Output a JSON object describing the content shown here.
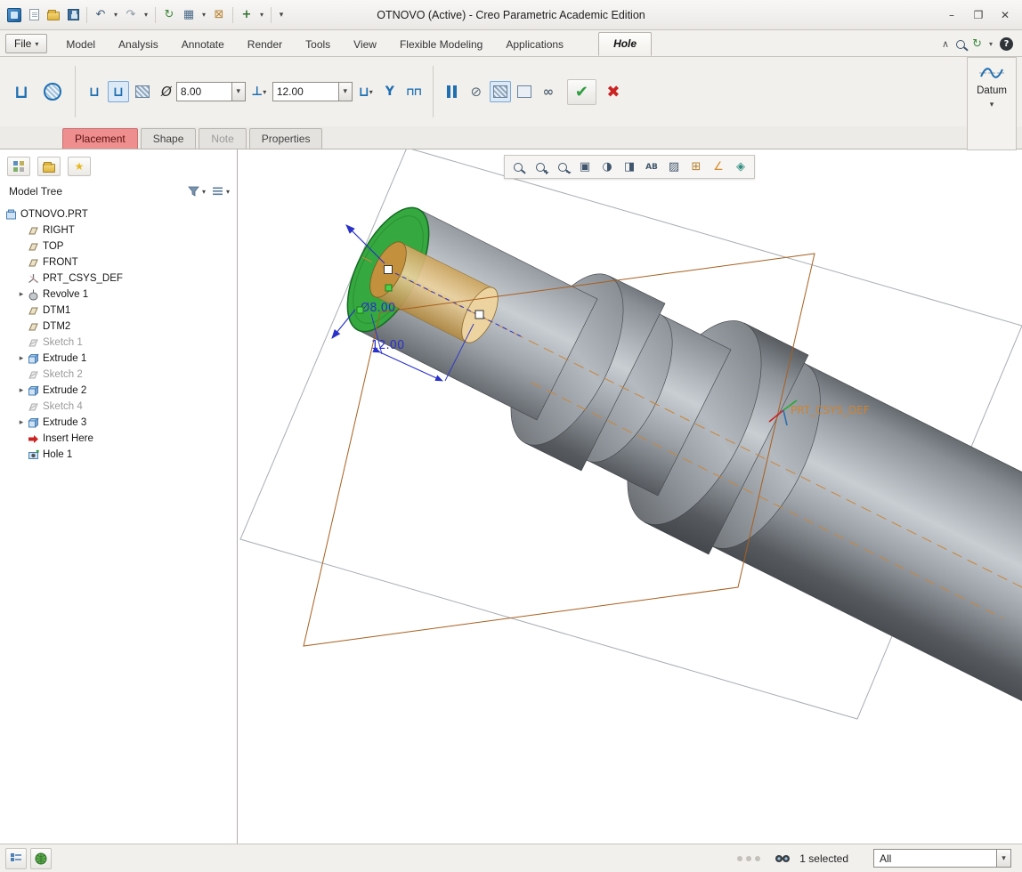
{
  "window": {
    "title": "OTNOVO (Active) - Creo Parametric Academic Edition"
  },
  "icons": {
    "dropdown": "▾",
    "expand": "▸",
    "undo": "↶",
    "redo": "↷",
    "regenerate": "↻",
    "windows": "▦",
    "close_window": "⊠",
    "plus": "+",
    "collapse": "∧",
    "help": "?",
    "minimize": "–",
    "maximize": "❐",
    "close": "✕",
    "u_profile": "⊔",
    "diameter": "Ø",
    "depth_side": "⊥",
    "tap": "Y",
    "counterbore": "⊓⊓",
    "no_preview": "⊘",
    "glasses": "∞",
    "check": "✔",
    "cancel": "✖",
    "ab": "AB",
    "refit": "▣",
    "display_style": "◑",
    "section": "◨",
    "render": "▨",
    "grid": "⊞",
    "angle": "∠",
    "viewmgr": "◈",
    "zoom_plus": "+",
    "zoom_minus": "−",
    "star": "★"
  },
  "ribbon": {
    "file_label": "File",
    "tabs": [
      "Model",
      "Analysis",
      "Annotate",
      "Render",
      "Tools",
      "View",
      "Flexible Modeling",
      "Applications"
    ],
    "active_tab": "Hole",
    "dashboard_tabs": [
      "Placement",
      "Shape",
      "Note",
      "Properties"
    ],
    "hole": {
      "diameter_value": "8.00",
      "depth_value": "12.00"
    },
    "datum_group_label": "Datum"
  },
  "model_tree": {
    "title": "Model Tree",
    "items": [
      {
        "label": "OTNOVO.PRT"
      },
      {
        "label": "RIGHT"
      },
      {
        "label": "TOP"
      },
      {
        "label": "FRONT"
      },
      {
        "label": "PRT_CSYS_DEF"
      },
      {
        "label": "Revolve 1"
      },
      {
        "label": "DTM1"
      },
      {
        "label": "DTM2"
      },
      {
        "label": "Sketch 1"
      },
      {
        "label": "Extrude 1"
      },
      {
        "label": "Sketch 2"
      },
      {
        "label": "Extrude 2"
      },
      {
        "label": "Sketch 4"
      },
      {
        "label": "Extrude 3"
      },
      {
        "label": "Insert Here"
      },
      {
        "label": "Hole 1"
      }
    ]
  },
  "viewport": {
    "dim_diameter": "Ø8.00",
    "dim_depth": "12.00",
    "csys_label": "PRT_CSYS_DEF"
  },
  "status_bar": {
    "selected_text": "1 selected",
    "filter_value": "All"
  },
  "colors": {
    "accent_blue": "#1f6fb2",
    "selection_green": "#35a83f",
    "preview_tan": "#d8a95e",
    "dimension_blue": "#2a31c8",
    "datum_brown": "#a85f1e",
    "placement_tab": "#ee8e8e"
  }
}
